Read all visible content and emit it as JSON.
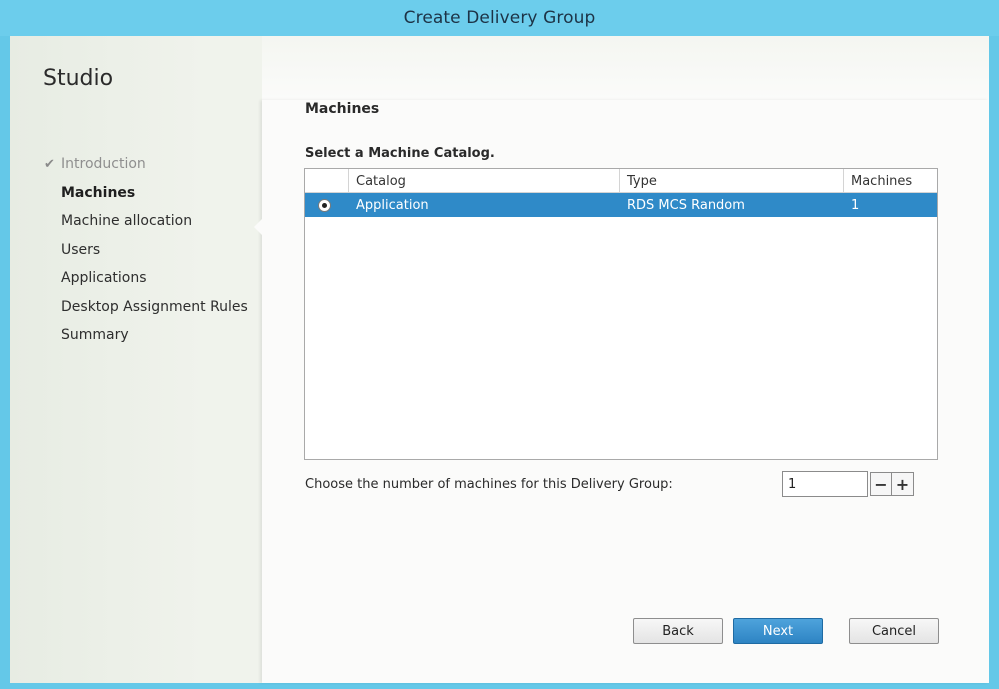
{
  "window": {
    "title": "Create Delivery Group"
  },
  "sidebar": {
    "app_title": "Studio",
    "steps": [
      {
        "label": "Introduction",
        "state": "done",
        "icon": "check-icon"
      },
      {
        "label": "Machines",
        "state": "current"
      },
      {
        "label": "Machine allocation",
        "state": "pending"
      },
      {
        "label": "Users",
        "state": "pending"
      },
      {
        "label": "Applications",
        "state": "pending"
      },
      {
        "label": "Desktop Assignment Rules",
        "state": "pending"
      },
      {
        "label": "Summary",
        "state": "pending"
      }
    ],
    "check_glyph": "✔"
  },
  "main": {
    "section_title": "Machines",
    "select_label": "Select a Machine Catalog.",
    "table": {
      "columns": [
        "",
        "Catalog",
        "Type",
        "Machines"
      ],
      "rows": [
        {
          "selected": true,
          "catalog": "Application",
          "type": "RDS MCS Random",
          "machines": "1"
        }
      ]
    },
    "count_label": "Choose the number of machines for this Delivery Group:",
    "count_value": "1",
    "stepper": {
      "minus": "−",
      "plus": "+"
    }
  },
  "buttons": {
    "back": "Back",
    "next": "Next",
    "cancel": "Cancel"
  },
  "colors": {
    "title_bar": "#6ccdec",
    "selection": "#2f8ac8",
    "primary_button": "#2e84c3"
  }
}
